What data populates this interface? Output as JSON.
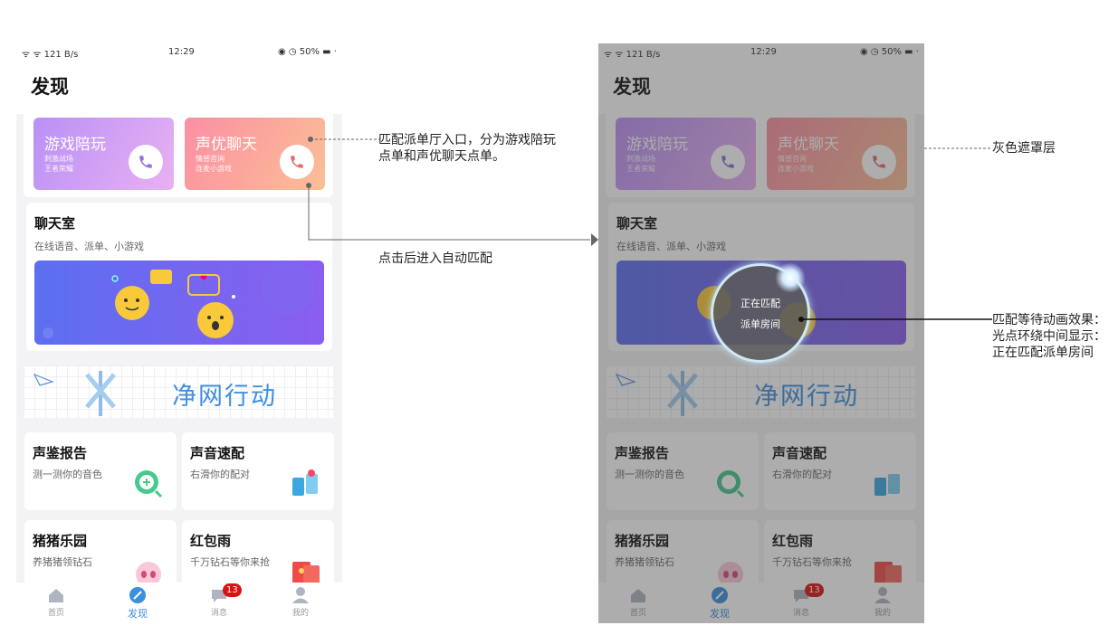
{
  "status_bar": {
    "signal": "ᯤ ᯤ 121 B/s",
    "time": "12:29",
    "right": "◉ ◷ 50% ▬ ·"
  },
  "page": {
    "title": "发现"
  },
  "entries": [
    {
      "name": "游戏陪玩",
      "sub1": "刺激战场",
      "sub2": "王者荣耀"
    },
    {
      "name": "声优聊天",
      "sub1": "情感咨询",
      "sub2": "连麦小游戏"
    }
  ],
  "chat_room": {
    "title": "聊天室",
    "desc": "在线语音、派单、小游戏"
  },
  "net_banner": {
    "text": "净网行动"
  },
  "tiles": [
    {
      "title": "声鉴报告",
      "desc": "测一测你的音色"
    },
    {
      "title": "声音速配",
      "desc": "右滑你的配对"
    },
    {
      "title": "猪猪乐园",
      "desc": "养猪猪领钻石"
    },
    {
      "title": "红包雨",
      "desc": "千万钻石等你来抢"
    }
  ],
  "tabbar": {
    "items": [
      {
        "label": "首页"
      },
      {
        "label": "发现"
      },
      {
        "label": "消息"
      },
      {
        "label": "我的"
      }
    ],
    "badge": "13"
  },
  "matching": {
    "line1": "正在匹配",
    "line2": "派单房间"
  },
  "annotations": {
    "entry_note": "匹配派单厅入口，分为游戏陪玩点单和声优聊天点单。",
    "auto_match_note": "点击后进入自动匹配",
    "mask_note": "灰色遮罩层",
    "anim_note": "匹配等待动画效果：光点环绕中间显示：正在匹配派单房间"
  },
  "colors": {
    "accent": "#3b8fe0",
    "game_gradient": "#b990f5",
    "voice_gradient": "#fb8fa4",
    "badge": "#dd1111"
  }
}
